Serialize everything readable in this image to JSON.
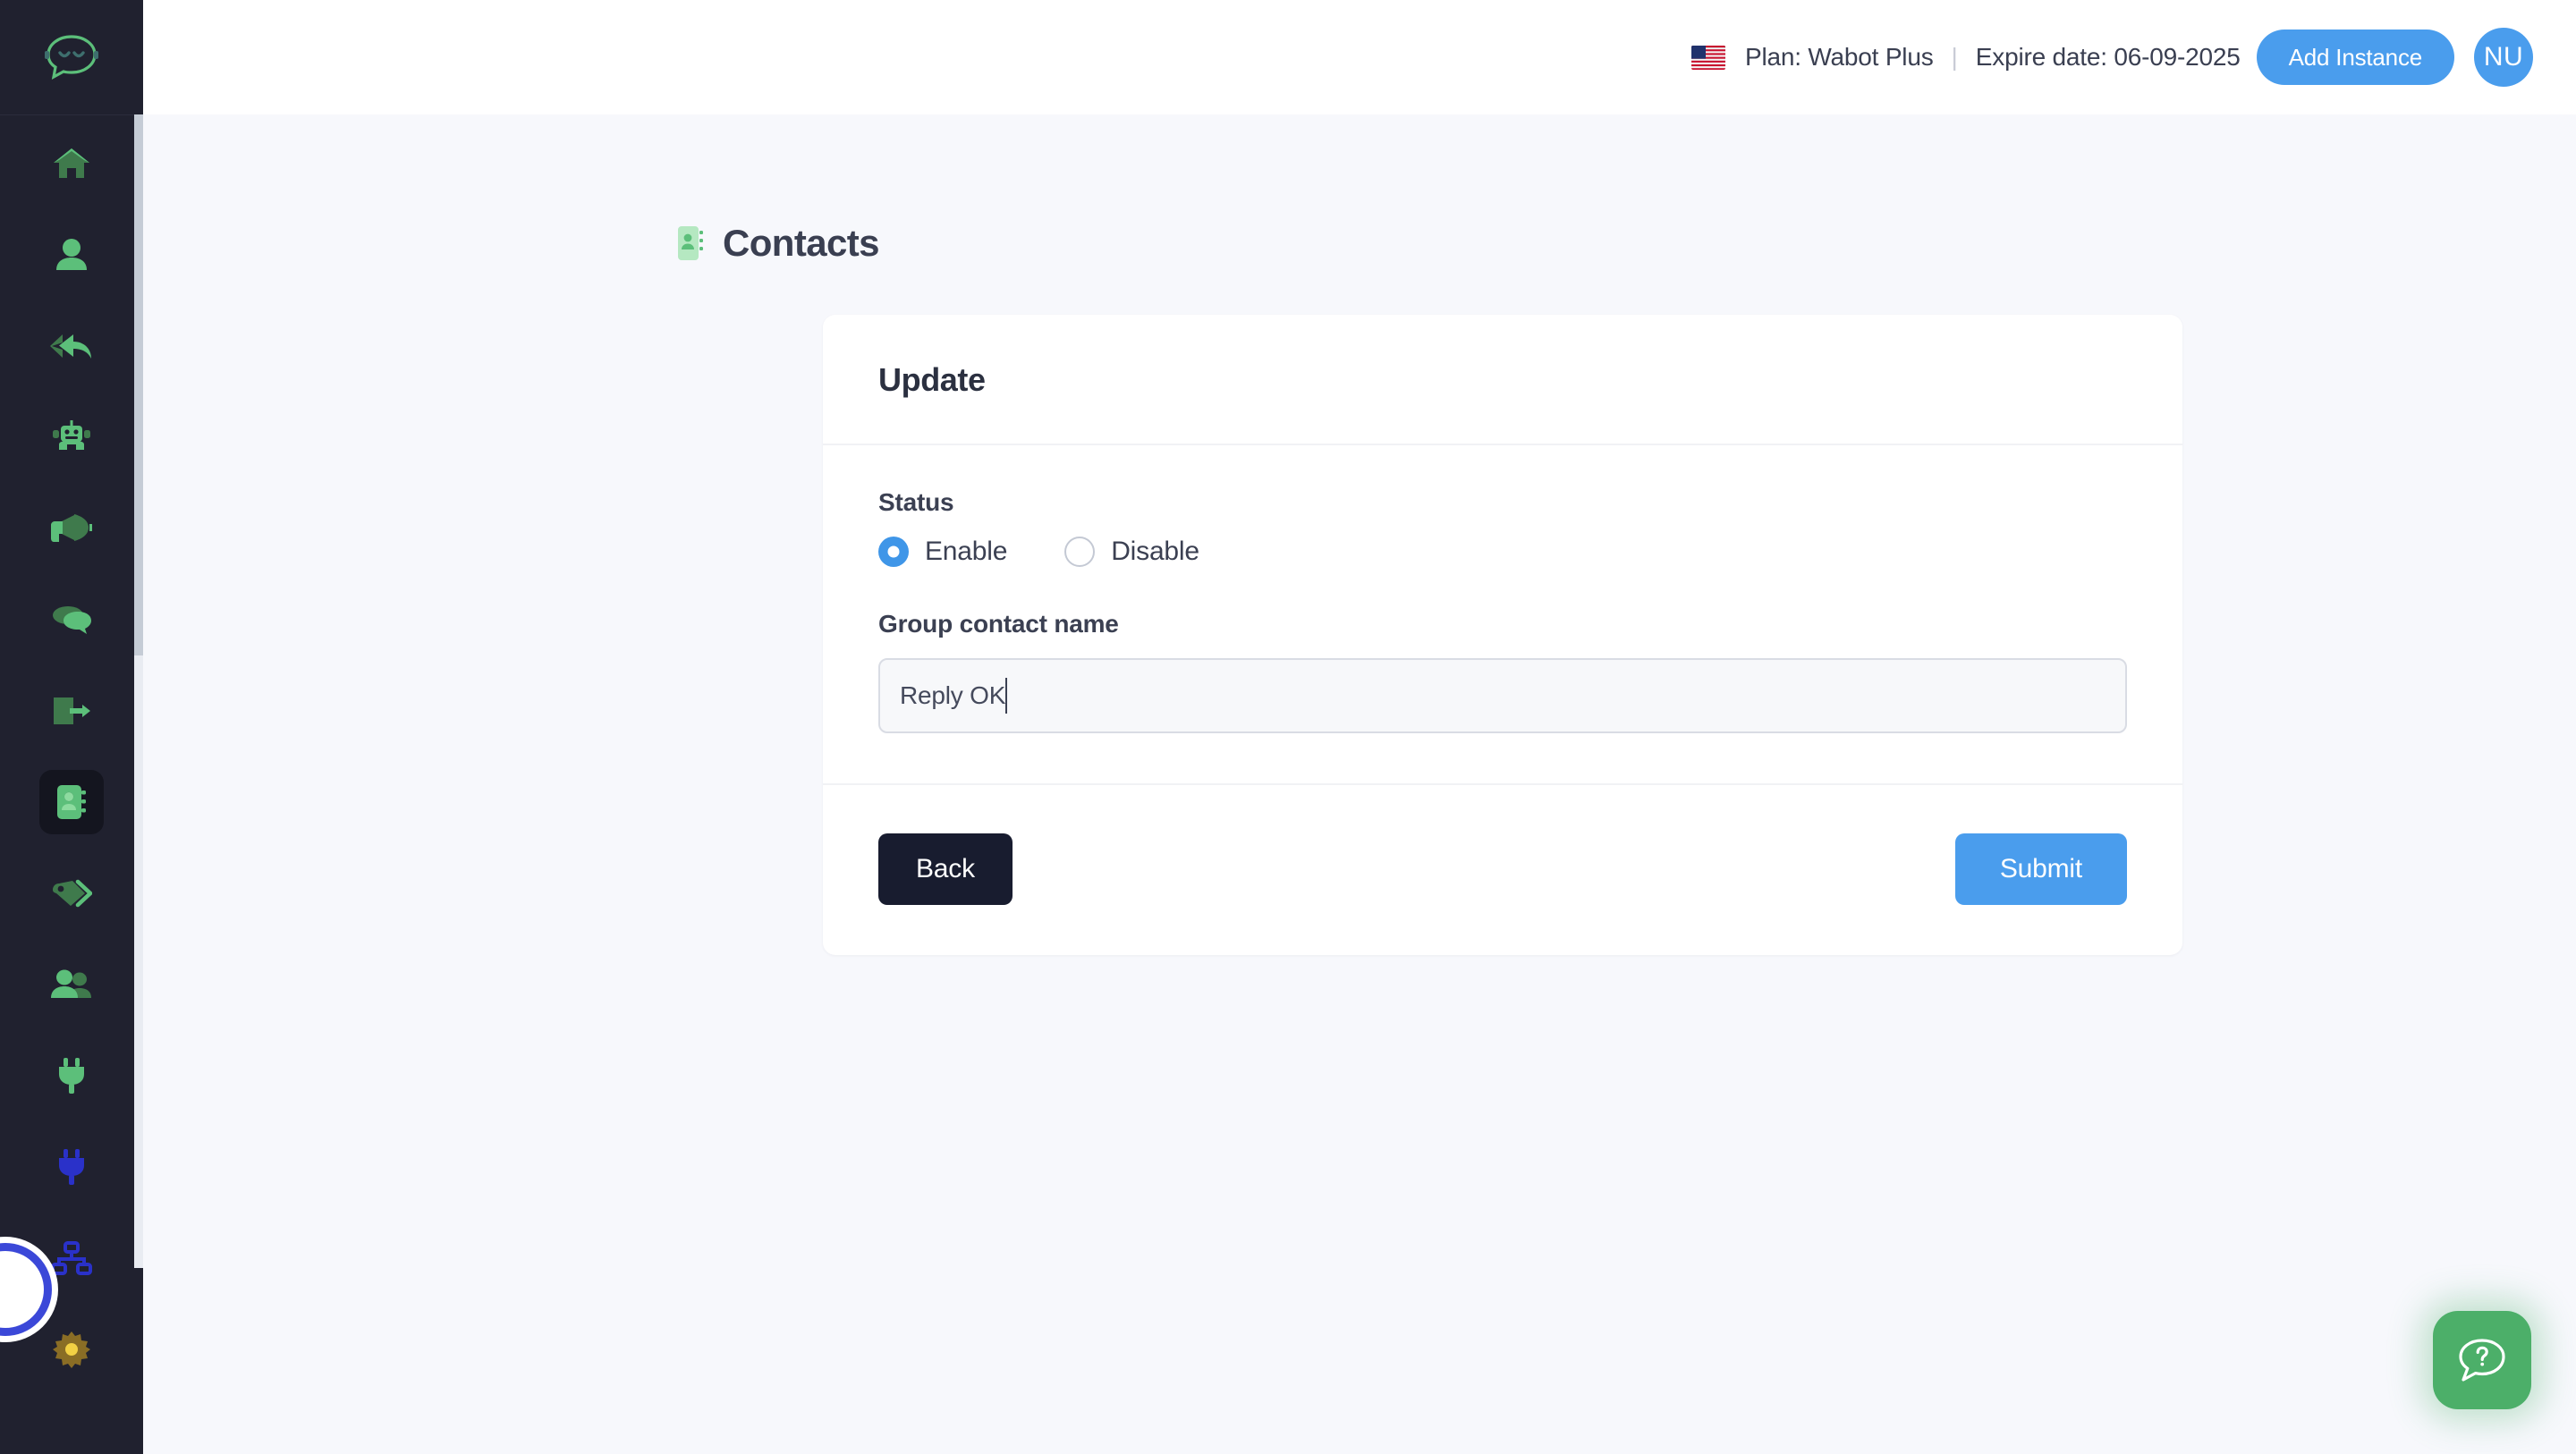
{
  "topbar": {
    "flag": "us-flag-icon",
    "plan_label": "Plan: Wabot Plus",
    "separator": "|",
    "expire_label": "Expire date: 06-09-2025",
    "add_instance_label": "Add Instance",
    "avatar_initials": "NU",
    "accent_color": "#4a9ded"
  },
  "page": {
    "title": "Contacts",
    "icon": "contact-book-icon"
  },
  "card": {
    "heading": "Update",
    "status": {
      "label": "Status",
      "options": [
        {
          "label": "Enable",
          "checked": true
        },
        {
          "label": "Disable",
          "checked": false
        }
      ]
    },
    "group_contact_name": {
      "label": "Group contact name",
      "value": "Reply OK",
      "placeholder": "Group contact name"
    },
    "buttons": {
      "back": "Back",
      "submit": "Submit"
    }
  },
  "sidebar": {
    "logo": "chat-bubble-logo",
    "items": [
      {
        "name": "home-icon",
        "active": false
      },
      {
        "name": "user-icon",
        "active": false
      },
      {
        "name": "reply-all-icon",
        "active": false
      },
      {
        "name": "robot-icon",
        "active": false
      },
      {
        "name": "megaphone-icon",
        "active": false
      },
      {
        "name": "chat-icon",
        "active": false
      },
      {
        "name": "export-icon",
        "active": false
      },
      {
        "name": "contact-book-icon",
        "active": true
      },
      {
        "name": "tags-icon",
        "active": false
      },
      {
        "name": "group-users-icon",
        "active": false
      },
      {
        "name": "plug-green-icon",
        "active": false
      },
      {
        "name": "plug-blue-icon",
        "active": false
      },
      {
        "name": "sitemap-icon",
        "active": false
      },
      {
        "name": "gear-icon",
        "active": false
      }
    ]
  },
  "help": {
    "fab": "help-chat-icon",
    "color": "#4caf69"
  }
}
